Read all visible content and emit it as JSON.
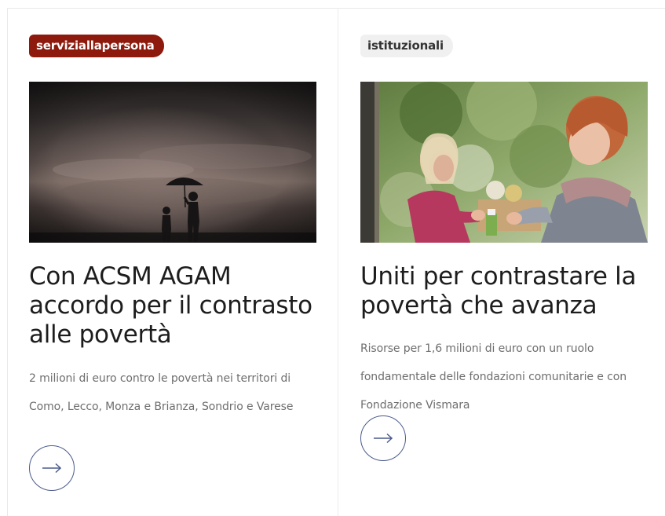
{
  "cards": [
    {
      "tag": "serviziallapersona",
      "title": "Con ACSM AGAM accordo per il contrasto alle povertà",
      "description": "2 milioni di euro contro le povertà nei territori di Como, Lecco, Monza e Brianza, Sondrio e Varese",
      "image_icon": "stormy-sky-umbrella-children-photo",
      "button_icon": "arrow-right-icon"
    },
    {
      "tag": "istituzionali",
      "title": "Uniti per contrastare la povertà che avanza",
      "description": "Risorse per 1,6 milioni di euro con un ruolo fondamentale delle fondazioni comunitarie e con Fondazione Vismara",
      "image_icon": "women-food-donation-photo",
      "button_icon": "arrow-right-icon"
    }
  ],
  "colors": {
    "tag_dark_bg": "#8d1a0c",
    "tag_light_bg": "#f0f0f0",
    "button_border": "#4a5a8c",
    "title_text": "#1d1d1d",
    "desc_text": "#6e6e6e"
  }
}
